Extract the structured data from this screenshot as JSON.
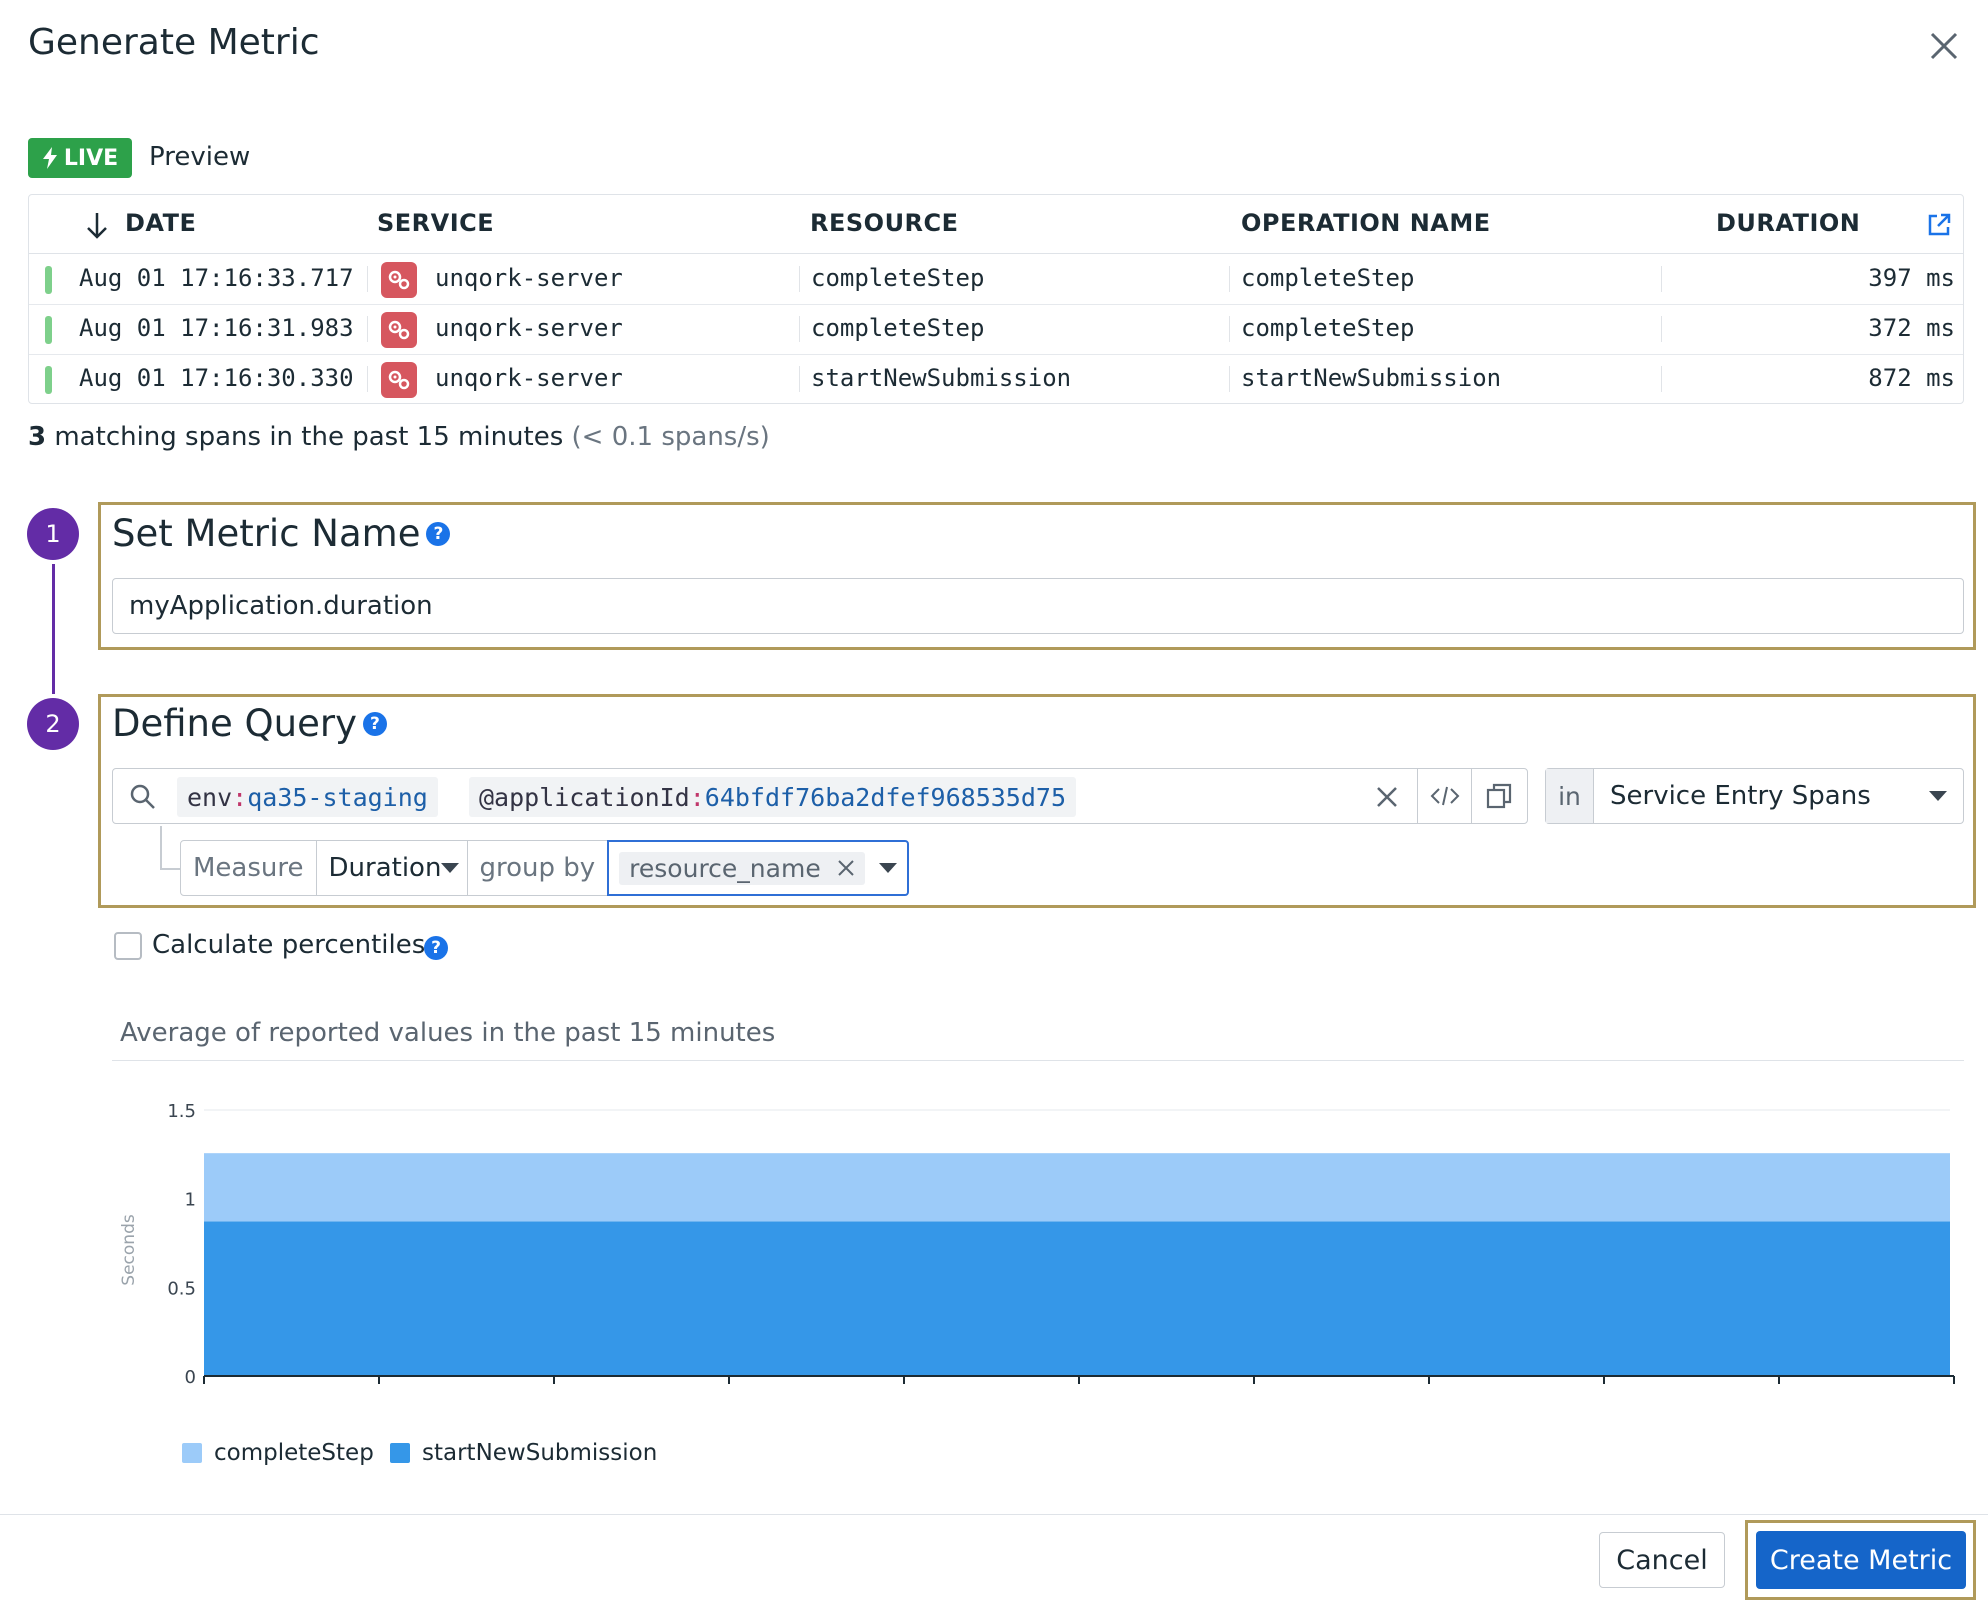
{
  "dialog": {
    "title": "Generate Metric"
  },
  "preview": {
    "live_label": "LIVE",
    "label": "Preview",
    "columns": [
      "DATE",
      "SERVICE",
      "RESOURCE",
      "OPERATION NAME",
      "DURATION"
    ],
    "rows": [
      {
        "date": "Aug 01 17:16:33.717",
        "service": "unqork-server",
        "resource": "completeStep",
        "operation": "completeStep",
        "duration": "397 ms"
      },
      {
        "date": "Aug 01 17:16:31.983",
        "service": "unqork-server",
        "resource": "completeStep",
        "operation": "completeStep",
        "duration": "372 ms"
      },
      {
        "date": "Aug 01 17:16:30.330",
        "service": "unqork-server",
        "resource": "startNewSubmission",
        "operation": "startNewSubmission",
        "duration": "872 ms"
      }
    ],
    "summary_count": "3",
    "summary_text": " matching spans in the past 15 minutes ",
    "summary_rate": "(< 0.1 spans/s)"
  },
  "step1": {
    "number": "1",
    "title": "Set Metric Name",
    "input_value": "myApplication.duration"
  },
  "step2": {
    "number": "2",
    "title": "Define Query",
    "tags": [
      {
        "key": "env",
        "colon": ":",
        "value": "qa35-staging"
      },
      {
        "key": "@applicationId",
        "colon": ":",
        "value": "64bfdf76ba2dfef968535d75"
      }
    ],
    "in_label": "in",
    "span_type": "Service Entry Spans",
    "measure_label": "Measure",
    "measure_value": "Duration",
    "group_by_label": "group by",
    "group_by_value": "resource_name"
  },
  "percentiles": {
    "label": "Calculate percentiles",
    "checked": false
  },
  "chart_data": {
    "type": "area",
    "title": "Average of reported values in the past 15 minutes",
    "ylabel": "Seconds",
    "ylim": [
      0,
      1.5
    ],
    "yticks": [
      "0",
      "0.5",
      "1",
      "1.5"
    ],
    "series": [
      {
        "name": "startNewSubmission",
        "value": 0.872,
        "color": "#3597e8"
      },
      {
        "name": "completeStep",
        "value": 0.3845,
        "color": "#9ccbf9"
      }
    ],
    "stacked": true
  },
  "footer": {
    "cancel_label": "Cancel",
    "create_label": "Create Metric"
  },
  "colors": {
    "accent": "#632ca6",
    "primary": "#1565c9",
    "live": "#2da14a"
  }
}
